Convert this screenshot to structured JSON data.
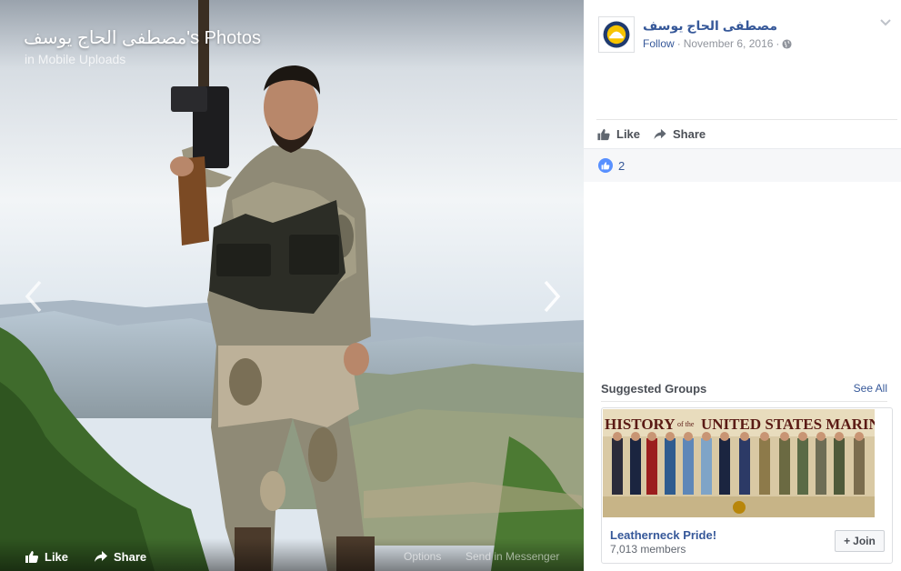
{
  "viewer": {
    "title_name": "مصطفى الحاج يوسف",
    "title_suffix": "'s Photos",
    "subtitle": "in Mobile Uploads",
    "like_label": "Like",
    "share_label": "Share",
    "options_label": "Options",
    "messenger_label": "Send in Messenger"
  },
  "post": {
    "author": "مصطفى الحاج يوسف",
    "follow_label": "Follow",
    "separator": "·",
    "date": "November 6, 2016",
    "separator2": "·",
    "like_label": "Like",
    "share_label": "Share",
    "reaction_count": "2"
  },
  "suggested": {
    "heading": "Suggested Groups",
    "see_all": "See All",
    "group": {
      "banner_text_1": "HISTORY",
      "banner_text_2": "of the",
      "banner_text_3": "UNITED STATES MARIN",
      "name": "Leatherneck Pride!",
      "members": "7,013 members",
      "join_label": "Join"
    }
  },
  "colors": {
    "link": "#365899",
    "like_blue": "#5890ff",
    "accent_yellow": "#f7c400"
  }
}
